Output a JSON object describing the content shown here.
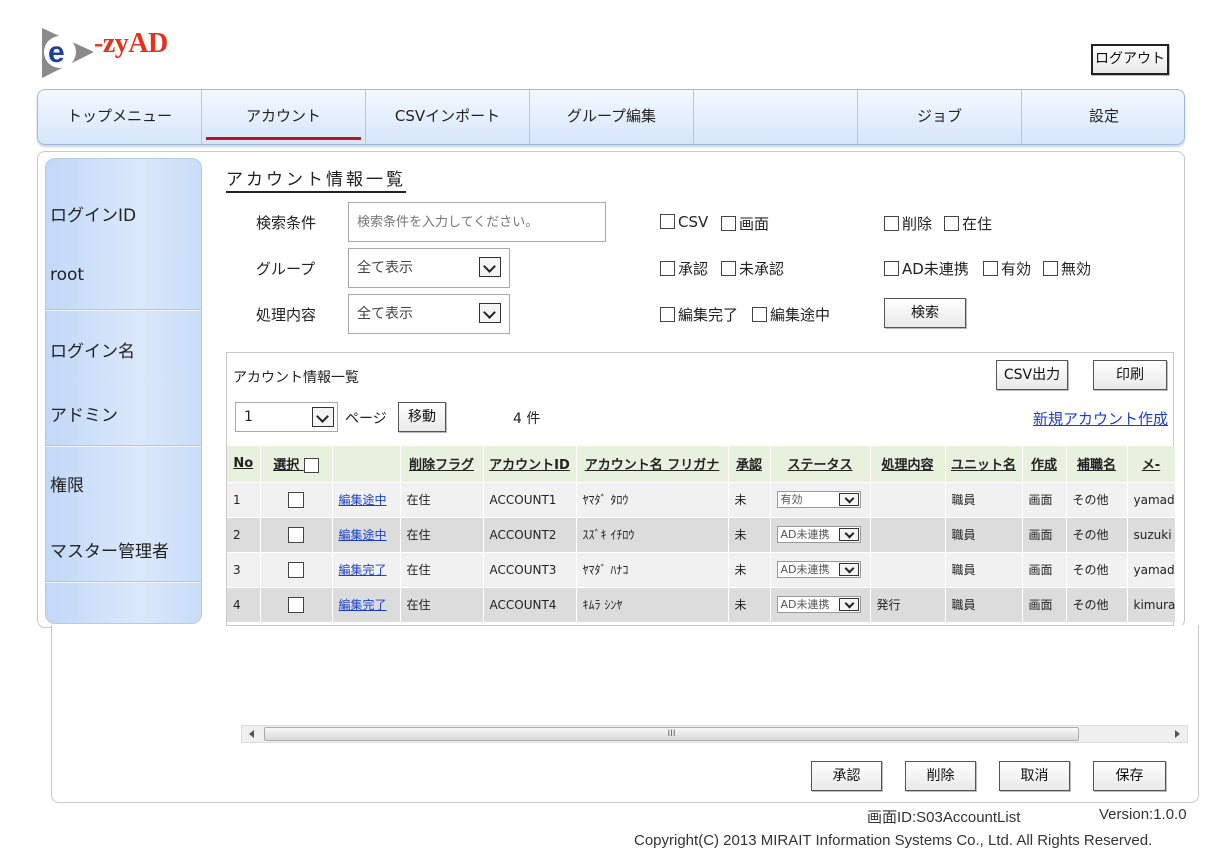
{
  "header": {
    "logo_text": "-zyAD",
    "logout_label": "ログアウト"
  },
  "nav": {
    "items": [
      {
        "label": "トップメニュー"
      },
      {
        "label": "アカウント"
      },
      {
        "label": "CSVインポート"
      },
      {
        "label": "グループ編集"
      },
      {
        "label": ""
      },
      {
        "label": "ジョブ"
      },
      {
        "label": "設定"
      }
    ],
    "active": "アカウント"
  },
  "side": {
    "login_id_label": "ログインID",
    "login_id_value": "root",
    "login_name_label": "ログイン名",
    "login_name_value": "アドミン",
    "role_label": "権限",
    "role_value": "マスター管理者"
  },
  "page": {
    "title": "アカウント情報一覧"
  },
  "search": {
    "condition_label": "検索条件",
    "condition_placeholder": "検索条件を入力してください。",
    "group_label": "グループ",
    "group_value": "全て表示",
    "process_label": "処理内容",
    "process_value": "全て表示",
    "checkboxes": {
      "csv": "CSV",
      "screen": "画面",
      "delete": "削除",
      "present": "在住",
      "approved": "承認",
      "unapproved": "未承認",
      "ad_unlinked": "AD未連携",
      "valid": "有効",
      "invalid": "無効",
      "edit_done": "編集完了",
      "edit_in_progress": "編集途中"
    },
    "search_button": "検索"
  },
  "list": {
    "title": "アカウント情報一覧",
    "csv_button": "CSV出力",
    "print_button": "印刷",
    "page_value": "1",
    "page_label": "ページ",
    "move_button": "移動",
    "count": "4 件",
    "new_account_link": "新規アカウント作成"
  },
  "table": {
    "columns": [
      "No",
      "選択",
      "",
      "削除フラグ",
      "アカウントID",
      "アカウント名 フリガナ",
      "承認",
      "ステータス",
      "処理内容",
      "ユニット名",
      "作成",
      "補職名",
      "メ-"
    ],
    "rows": [
      {
        "no": "1",
        "edit": "編集途中",
        "flag": "在住",
        "id": "ACCOUNT1",
        "kana": "ﾔﾏﾀﾞ ﾀﾛｳ",
        "approval": "未",
        "status": "有効",
        "process": "",
        "unit": "職員",
        "create": "画面",
        "post": "その他",
        "mail": "yamad"
      },
      {
        "no": "2",
        "edit": "編集途中",
        "flag": "在住",
        "id": "ACCOUNT2",
        "kana": "ｽｽﾞｷ ｲﾁﾛｳ",
        "approval": "未",
        "status": "AD未連携",
        "process": "",
        "unit": "職員",
        "create": "画面",
        "post": "その他",
        "mail": "suzuki"
      },
      {
        "no": "3",
        "edit": "編集完了",
        "flag": "在住",
        "id": "ACCOUNT3",
        "kana": "ﾔﾏﾀﾞ ﾊﾅｺ",
        "approval": "未",
        "status": "AD未連携",
        "process": "",
        "unit": "職員",
        "create": "画面",
        "post": "その他",
        "mail": "yamad"
      },
      {
        "no": "4",
        "edit": "編集完了",
        "flag": "在住",
        "id": "ACCOUNT4",
        "kana": "ｷﾑﾗ ｼﾝﾔ",
        "approval": "未",
        "status": "AD未連携",
        "process": "発行",
        "unit": "職員",
        "create": "画面",
        "post": "その他",
        "mail": "kimura"
      }
    ]
  },
  "scrollbar": {
    "grip": "III"
  },
  "actions": {
    "approve": "承認",
    "delete": "削除",
    "cancel": "取消",
    "save": "保存"
  },
  "footer": {
    "screen_id": "画面ID:S03AccountList",
    "version": "Version:1.0.0",
    "copyright": "Copyright(C) 2013 MIRAIT Information Systems Co., Ltd. All Rights Reserved."
  },
  "colors": {
    "nav_active_underline": "#c0121a",
    "link": "#1a3fd0",
    "table_header": "#e8f1de",
    "side_panel": "#c2d8f7"
  }
}
